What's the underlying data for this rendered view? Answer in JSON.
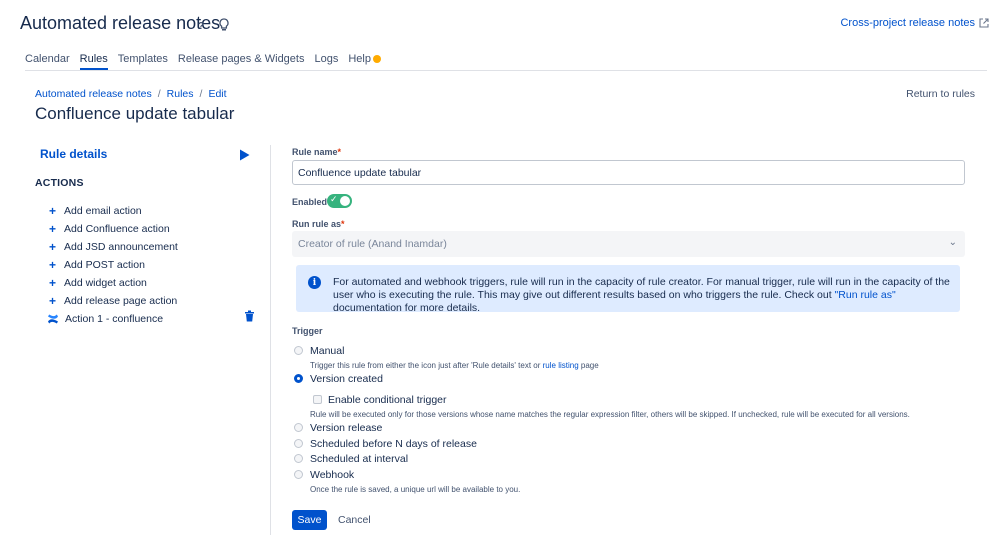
{
  "header": {
    "app_title": "Automated release notes",
    "help_icon": "question-icon",
    "idea_icon": "lightbulb-icon",
    "cross_project_link": "Cross-project release notes",
    "external_icon": "external-link-icon"
  },
  "tabs": [
    {
      "label": "Calendar",
      "active": false
    },
    {
      "label": "Rules",
      "active": true
    },
    {
      "label": "Templates",
      "active": false
    },
    {
      "label": "Release pages & Widgets",
      "active": false
    },
    {
      "label": "Logs",
      "active": false
    },
    {
      "label": "Help",
      "active": false
    }
  ],
  "breadcrumbs": [
    "Automated release notes",
    "Rules",
    "Edit"
  ],
  "page_title": "Confluence update tabular",
  "return_button": "Return to rules",
  "sidebar": {
    "rule_details": "Rule details",
    "actions_heading": "ACTIONS",
    "actions": [
      "Add email action",
      "Add Confluence action",
      "Add JSD announcement",
      "Add POST action",
      "Add widget action",
      "Add release page action"
    ],
    "existing_action": "Action 1 - confluence"
  },
  "form": {
    "rule_name_label": "Rule name",
    "required_mark": "*",
    "rule_name_value": "Confluence update tabular",
    "enabled_label": "Enabled",
    "enabled": true,
    "run_as_label": "Run rule as",
    "run_as_value": "Creator of rule (Anand Inamdar)",
    "info": {
      "text1": "For automated and webhook triggers, rule will run in the capacity of rule creator. For manual trigger, rule will run in the capacity of the user who is executing the rule. This may give out different results based on who triggers the rule. Check out ",
      "link": "\"Run rule as\"",
      "text2": " documentation for more details."
    },
    "trigger_label": "Trigger",
    "triggers": {
      "manual": "Manual",
      "manual_desc1": "Trigger this rule from either the icon just after 'Rule details' text or ",
      "manual_desc_link": "rule listing",
      "manual_desc2": " page",
      "version_created": "Version created",
      "conditional_label": "Enable conditional trigger",
      "conditional_desc": "Rule will be executed only for those versions whose name matches the regular expression filter, others will be skipped. If unchecked, rule will be executed for all versions.",
      "version_release": "Version release",
      "scheduled_before": "Scheduled before N days of release",
      "scheduled_interval": "Scheduled at interval",
      "webhook": "Webhook",
      "webhook_desc": "Once the rule is saved, a unique url will be available to you."
    },
    "selected_trigger": "Version created",
    "save": "Save",
    "cancel": "Cancel"
  },
  "colors": {
    "primary": "#0052cc",
    "info_bg": "#deebff",
    "toggle_on": "#36b37e",
    "help_dot": "#ffab00"
  }
}
